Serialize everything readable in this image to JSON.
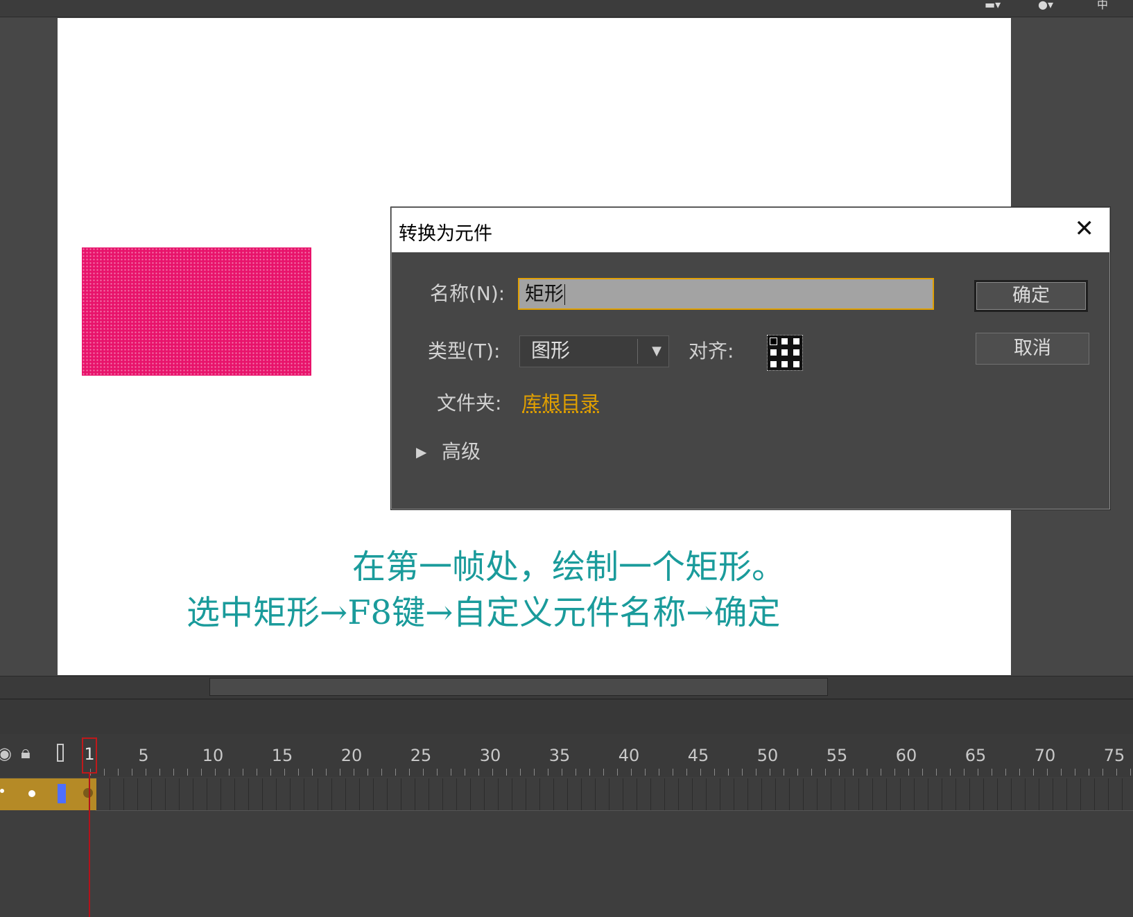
{
  "app": {
    "top_icons": [
      "layer-icon",
      "camera-icon",
      "center-icon"
    ]
  },
  "stage": {
    "caption_line1": "在第一帧处，绘制一个矩形。",
    "caption_line2": "选中矩形→F8键→自定义元件名称→确定",
    "shape_color": "#e8136b"
  },
  "dialog": {
    "title": "转换为元件",
    "close_glyph": "✕",
    "name_label": "名称(N):",
    "name_value": "矩形",
    "type_label": "类型(T):",
    "type_value": "图形",
    "align_label": "对齐:",
    "folder_label": "文件夹:",
    "folder_value": "库根目录",
    "advanced_label": "高级",
    "ok_label": "确定",
    "cancel_label": "取消"
  },
  "timeline": {
    "current_frame": "1",
    "ruler_labels": [
      "5",
      "10",
      "15",
      "20",
      "25",
      "30",
      "35",
      "40",
      "45",
      "50",
      "55",
      "60",
      "65",
      "70",
      "75"
    ]
  },
  "colors": {
    "accent": "#e1a000",
    "caption": "#1a9b9b",
    "playhead": "#c0191b",
    "layer": "#b58a26"
  }
}
